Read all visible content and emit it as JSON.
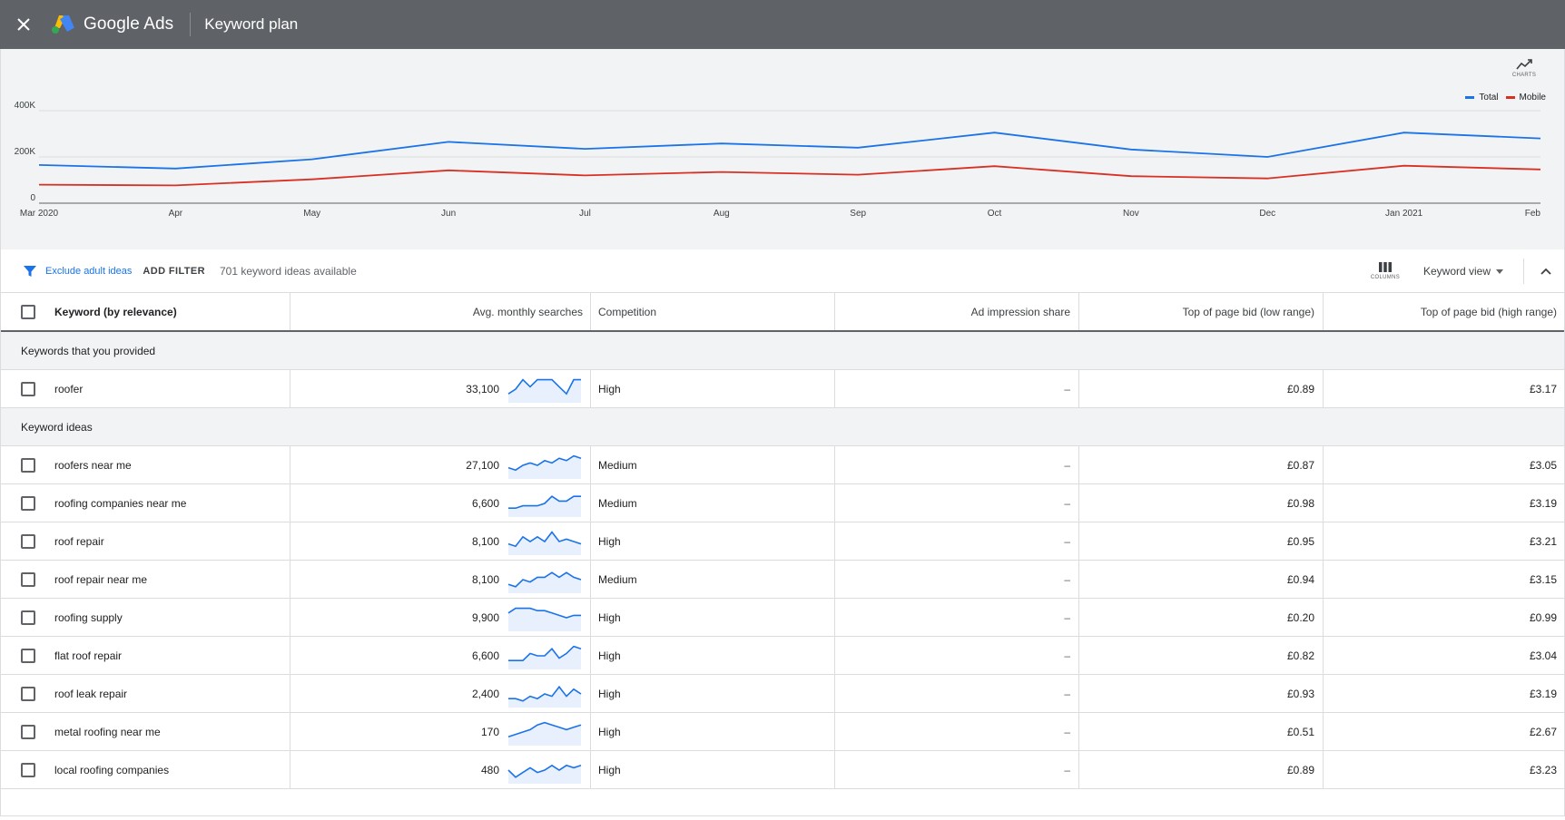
{
  "header": {
    "close_icon": "close-icon",
    "brand": "Google Ads",
    "title": "Keyword plan"
  },
  "chart_data": {
    "type": "line",
    "x": [
      "Mar 2020",
      "Apr",
      "May",
      "Jun",
      "Jul",
      "Aug",
      "Sep",
      "Oct",
      "Nov",
      "Dec",
      "Jan 2021",
      "Feb"
    ],
    "y_ticks": [
      "0",
      "200K",
      "400K"
    ],
    "ylim": [
      0,
      400000
    ],
    "series": [
      {
        "name": "Total",
        "color": "#1a73e8",
        "values": [
          165000,
          150000,
          190000,
          265000,
          235000,
          258000,
          240000,
          305000,
          232000,
          200000,
          305000,
          280000
        ]
      },
      {
        "name": "Mobile",
        "color": "#d93025",
        "values": [
          80000,
          77000,
          103000,
          142000,
          120000,
          135000,
          123000,
          160000,
          117000,
          107000,
          162000,
          146000
        ]
      }
    ],
    "grid": true,
    "legend": "top-right"
  },
  "charts_button": {
    "label": "CHARTS",
    "icon": "trending-up-icon"
  },
  "filterbar": {
    "filter_icon": "filter-icon",
    "chip": "Exclude adult ideas",
    "add_filter": "ADD FILTER",
    "count_text": "701 keyword ideas available",
    "columns_label": "COLUMNS",
    "view_label": "Keyword view"
  },
  "table": {
    "columns": {
      "keyword": "Keyword (by relevance)",
      "avg": "Avg. monthly searches",
      "competition": "Competition",
      "impression": "Ad impression share",
      "low": "Top of page bid (low range)",
      "high": "Top of page bid (high range)"
    },
    "groups": {
      "provided": "Keywords that you provided",
      "ideas": "Keyword ideas"
    },
    "provided_rows": [
      {
        "keyword": "roofer",
        "avg": "33,100",
        "competition": "High",
        "impression": "–",
        "low": "£0.89",
        "high": "£3.17",
        "trend": [
          3,
          5,
          9,
          6,
          9,
          9,
          9,
          6,
          3,
          9,
          9
        ]
      }
    ],
    "idea_rows": [
      {
        "keyword": "roofers near me",
        "avg": "27,100",
        "competition": "Medium",
        "impression": "–",
        "low": "£0.87",
        "high": "£3.05",
        "trend": [
          4,
          3,
          5,
          6,
          5,
          7,
          6,
          8,
          7,
          9,
          8
        ]
      },
      {
        "keyword": "roofing companies near me",
        "avg": "6,600",
        "competition": "Medium",
        "impression": "–",
        "low": "£0.98",
        "high": "£3.19",
        "trend": [
          3,
          3,
          4,
          4,
          4,
          5,
          8,
          6,
          6,
          8,
          8
        ]
      },
      {
        "keyword": "roof repair",
        "avg": "8,100",
        "competition": "High",
        "impression": "–",
        "low": "£0.95",
        "high": "£3.21",
        "trend": [
          4,
          3,
          7,
          5,
          7,
          5,
          9,
          5,
          6,
          5,
          4
        ]
      },
      {
        "keyword": "roof repair near me",
        "avg": "8,100",
        "competition": "Medium",
        "impression": "–",
        "low": "£0.94",
        "high": "£3.15",
        "trend": [
          3,
          2,
          5,
          4,
          6,
          6,
          8,
          6,
          8,
          6,
          5
        ]
      },
      {
        "keyword": "roofing supply",
        "avg": "9,900",
        "competition": "High",
        "impression": "–",
        "low": "£0.20",
        "high": "£0.99",
        "trend": [
          7,
          9,
          9,
          9,
          8,
          8,
          7,
          6,
          5,
          6,
          6
        ]
      },
      {
        "keyword": "flat roof repair",
        "avg": "6,600",
        "competition": "High",
        "impression": "–",
        "low": "£0.82",
        "high": "£3.04",
        "trend": [
          3,
          3,
          3,
          6,
          5,
          5,
          8,
          4,
          6,
          9,
          8
        ]
      },
      {
        "keyword": "roof leak repair",
        "avg": "2,400",
        "competition": "High",
        "impression": "–",
        "low": "£0.93",
        "high": "£3.19",
        "trend": [
          3,
          3,
          2,
          4,
          3,
          5,
          4,
          8,
          4,
          7,
          5
        ]
      },
      {
        "keyword": "metal roofing near me",
        "avg": "170",
        "competition": "High",
        "impression": "–",
        "low": "£0.51",
        "high": "£2.67",
        "trend": [
          3,
          4,
          5,
          6,
          8,
          9,
          8,
          7,
          6,
          7,
          8
        ]
      },
      {
        "keyword": "local roofing companies",
        "avg": "480",
        "competition": "High",
        "impression": "–",
        "low": "£0.89",
        "high": "£3.23",
        "trend": [
          5,
          2,
          4,
          6,
          4,
          5,
          7,
          5,
          7,
          6,
          7
        ]
      }
    ]
  }
}
